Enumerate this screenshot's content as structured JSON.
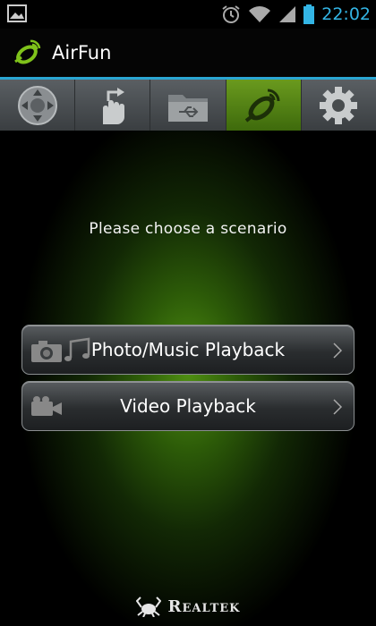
{
  "status_bar": {
    "time": "22:02"
  },
  "app": {
    "title": "AirFun"
  },
  "tabs": [
    {
      "name": "remote"
    },
    {
      "name": "share"
    },
    {
      "name": "usb-folder"
    },
    {
      "name": "airfun",
      "active": true
    },
    {
      "name": "settings"
    }
  ],
  "main": {
    "prompt": "Please choose a scenario",
    "choices": [
      {
        "label": "Photo/Music Playback"
      },
      {
        "label": "Video Playback"
      }
    ],
    "brand": "Realtek"
  },
  "colors": {
    "accent": "#33b5e5",
    "active_tab": "#5a8c18"
  }
}
